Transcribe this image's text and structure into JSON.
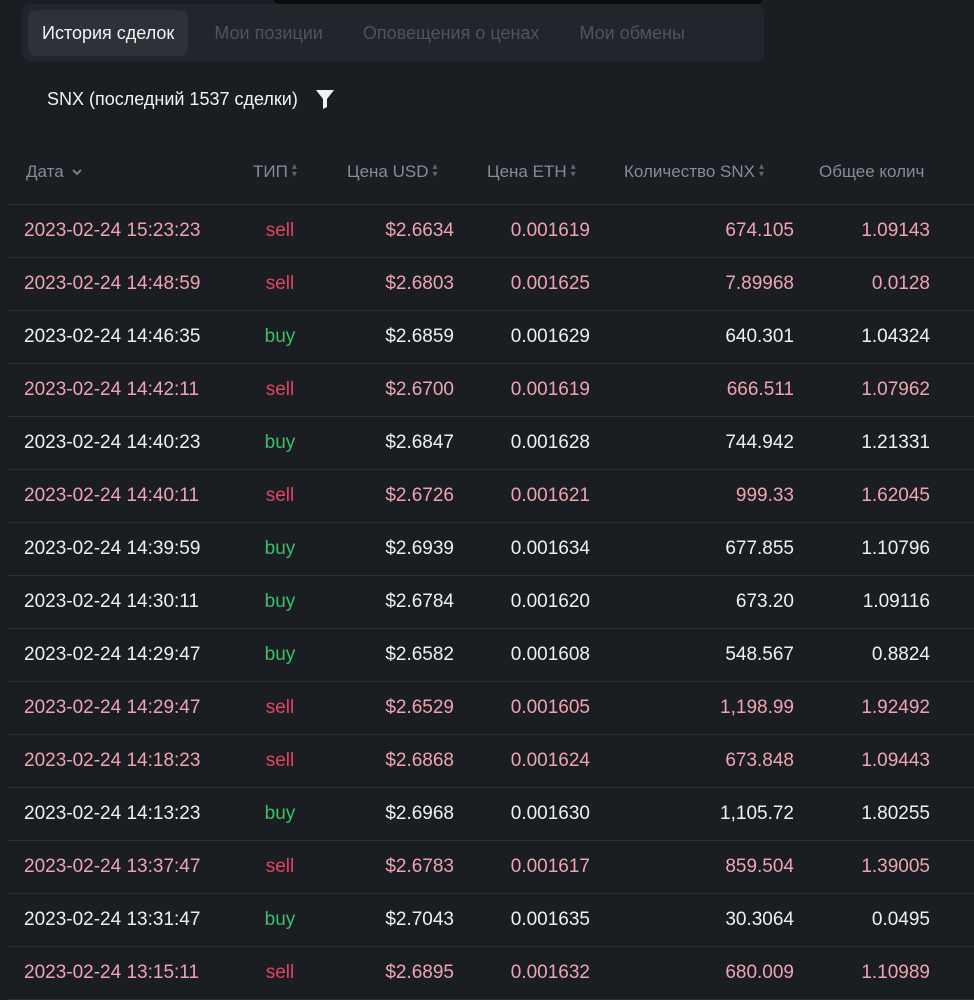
{
  "tabs": [
    {
      "label": "История сделок",
      "active": true
    },
    {
      "label": "Мои позиции",
      "active": false
    },
    {
      "label": "Оповещения о ценах",
      "active": false
    },
    {
      "label": "Мои обмены",
      "active": false
    }
  ],
  "subtitle": "SNX (последний 1537 сделки)",
  "icons": {
    "filter": "filter-icon",
    "sort": "sort-arrows-icon",
    "chevron": "chevron-down-icon"
  },
  "columns": {
    "date": "Дата",
    "type": "ТИП",
    "price_usd": "Цена USD",
    "price_eth": "Цена ETH",
    "qty": "Количество SNX",
    "total": "Общее колич"
  },
  "colors": {
    "sell_text": "#f0a3b1",
    "sell_type": "#e2455f",
    "buy_type": "#3fbe68",
    "background": "#1a1d22"
  },
  "rows": [
    {
      "date": "2023-02-24 15:23:23",
      "type": "sell",
      "usd": "$2.6634",
      "eth": "0.001619",
      "qty": "674.105",
      "total": "1.09143"
    },
    {
      "date": "2023-02-24 14:48:59",
      "type": "sell",
      "usd": "$2.6803",
      "eth": "0.001625",
      "qty": "7.89968",
      "total": "0.0128"
    },
    {
      "date": "2023-02-24 14:46:35",
      "type": "buy",
      "usd": "$2.6859",
      "eth": "0.001629",
      "qty": "640.301",
      "total": "1.04324"
    },
    {
      "date": "2023-02-24 14:42:11",
      "type": "sell",
      "usd": "$2.6700",
      "eth": "0.001619",
      "qty": "666.511",
      "total": "1.07962"
    },
    {
      "date": "2023-02-24 14:40:23",
      "type": "buy",
      "usd": "$2.6847",
      "eth": "0.001628",
      "qty": "744.942",
      "total": "1.21331"
    },
    {
      "date": "2023-02-24 14:40:11",
      "type": "sell",
      "usd": "$2.6726",
      "eth": "0.001621",
      "qty": "999.33",
      "total": "1.62045"
    },
    {
      "date": "2023-02-24 14:39:59",
      "type": "buy",
      "usd": "$2.6939",
      "eth": "0.001634",
      "qty": "677.855",
      "total": "1.10796"
    },
    {
      "date": "2023-02-24 14:30:11",
      "type": "buy",
      "usd": "$2.6784",
      "eth": "0.001620",
      "qty": "673.20",
      "total": "1.09116"
    },
    {
      "date": "2023-02-24 14:29:47",
      "type": "buy",
      "usd": "$2.6582",
      "eth": "0.001608",
      "qty": "548.567",
      "total": "0.8824"
    },
    {
      "date": "2023-02-24 14:29:47",
      "type": "sell",
      "usd": "$2.6529",
      "eth": "0.001605",
      "qty": "1,198.99",
      "total": "1.92492"
    },
    {
      "date": "2023-02-24 14:18:23",
      "type": "sell",
      "usd": "$2.6868",
      "eth": "0.001624",
      "qty": "673.848",
      "total": "1.09443"
    },
    {
      "date": "2023-02-24 14:13:23",
      "type": "buy",
      "usd": "$2.6968",
      "eth": "0.001630",
      "qty": "1,105.72",
      "total": "1.80255"
    },
    {
      "date": "2023-02-24 13:37:47",
      "type": "sell",
      "usd": "$2.6783",
      "eth": "0.001617",
      "qty": "859.504",
      "total": "1.39005"
    },
    {
      "date": "2023-02-24 13:31:47",
      "type": "buy",
      "usd": "$2.7043",
      "eth": "0.001635",
      "qty": "30.3064",
      "total": "0.0495"
    },
    {
      "date": "2023-02-24 13:15:11",
      "type": "sell",
      "usd": "$2.6895",
      "eth": "0.001632",
      "qty": "680.009",
      "total": "1.10989"
    }
  ]
}
